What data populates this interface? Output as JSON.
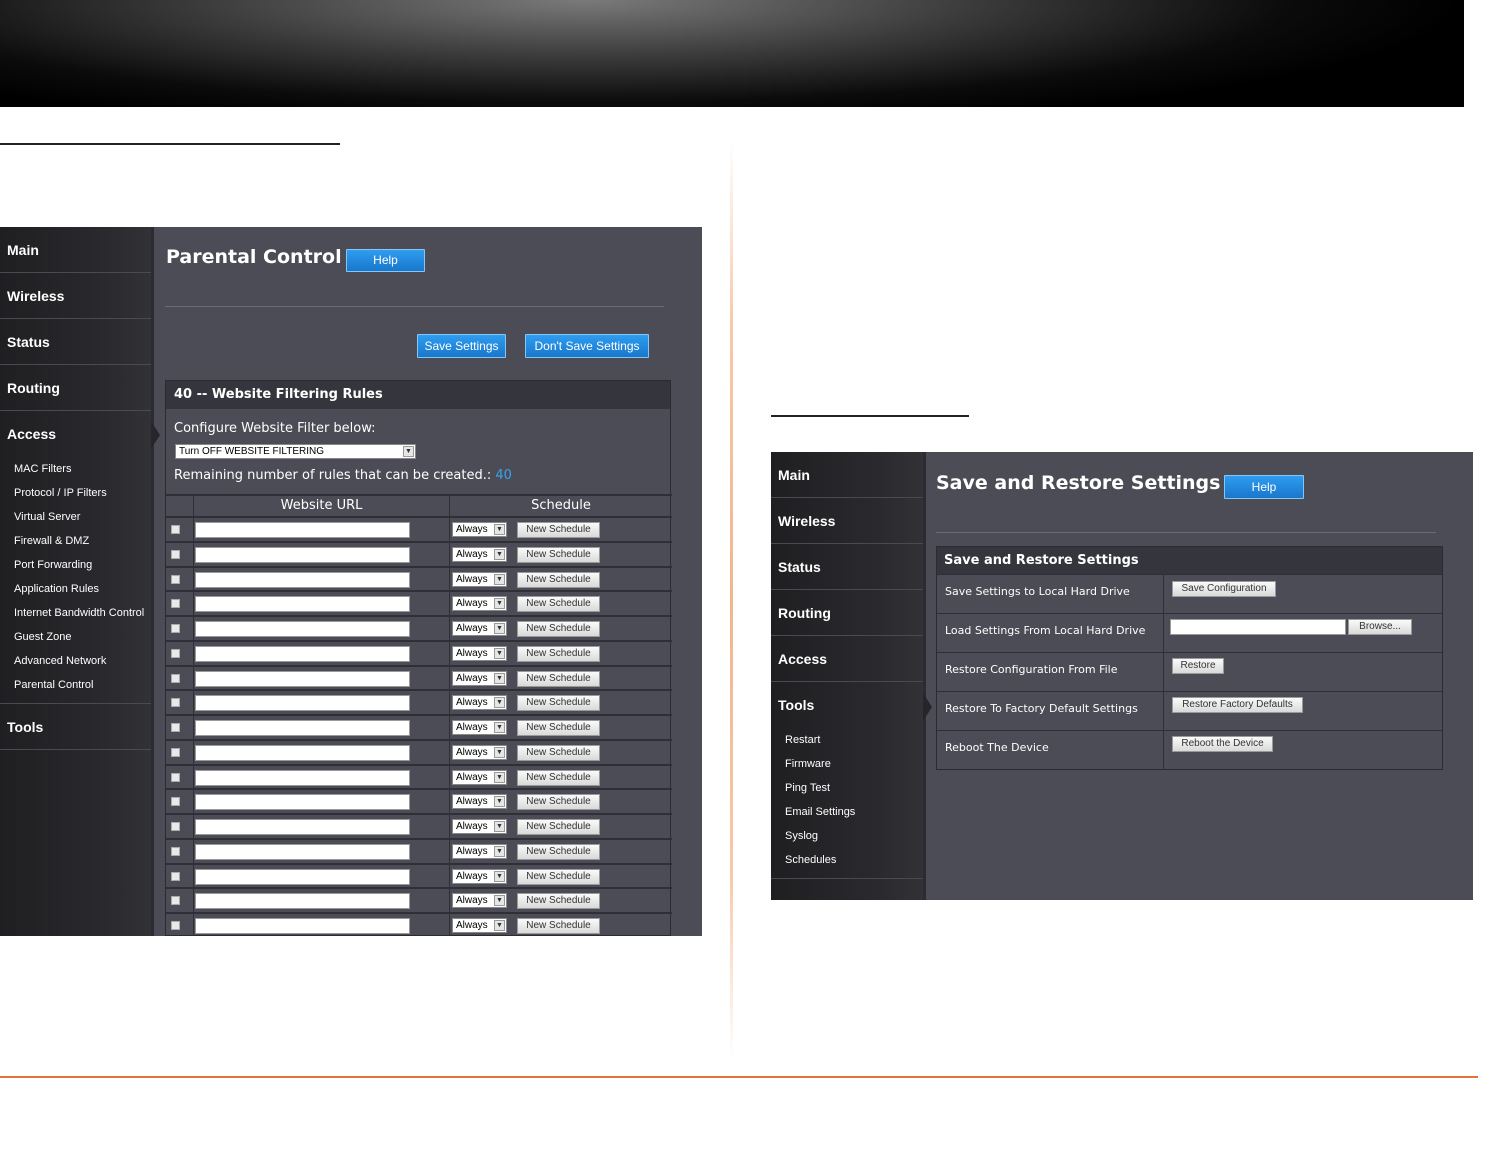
{
  "parental": {
    "nav": [
      "Main",
      "Wireless",
      "Status",
      "Routing",
      "Access"
    ],
    "access_sub": [
      "MAC Filters",
      "Protocol / IP Filters",
      "Virtual Server",
      "Firewall & DMZ",
      "Port Forwarding",
      "Application Rules",
      "Internet Bandwidth Control",
      "Guest Zone",
      "Advanced Network",
      "Parental Control"
    ],
    "tools": "Tools",
    "title": "Parental Control",
    "help": "Help",
    "save": "Save Settings",
    "dont_save": "Don't Save Settings",
    "rules_title": "40 -- Website Filtering Rules",
    "configure_label": "Configure Website Filter below:",
    "filter_select": "Turn OFF WEBSITE FILTERING",
    "remaining_label": "Remaining number of rules that can be created.:",
    "remaining_value": "40",
    "col_url": "Website URL",
    "col_schedule": "Schedule",
    "schedule_value": "Always",
    "new_schedule": "New Schedule"
  },
  "restore": {
    "nav": [
      "Main",
      "Wireless",
      "Status",
      "Routing",
      "Access"
    ],
    "tools": "Tools",
    "tools_sub": [
      "Restart",
      "Firmware",
      "Ping Test",
      "Email Settings",
      "Syslog",
      "Schedules"
    ],
    "title": "Save and Restore Settings",
    "help": "Help",
    "box_title": "Save and Restore Settings",
    "rows": [
      {
        "label": "Save Settings to Local Hard Drive",
        "button": "Save Configuration"
      },
      {
        "label": "Load Settings From Local Hard Drive",
        "button": "Browse..."
      },
      {
        "label": "Restore Configuration From File",
        "button": "Restore"
      },
      {
        "label": "Restore To Factory Default Settings",
        "button": "Restore Factory Defaults"
      },
      {
        "label": "Reboot The Device",
        "button": "Reboot the Device"
      }
    ]
  },
  "colors": {
    "accent_blue": "#1e88e5",
    "footer_orange": "#e8703a",
    "panel_bg": "#4b4c55"
  }
}
